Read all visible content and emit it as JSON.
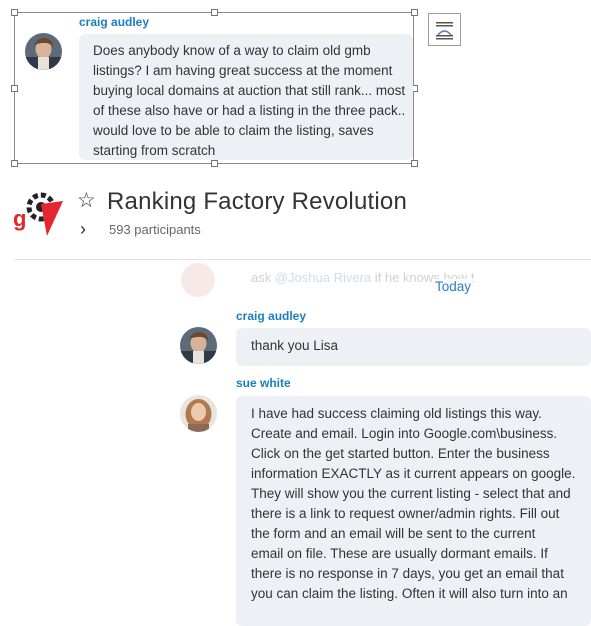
{
  "embedded_message": {
    "sender": "craig audley",
    "text": "Does anybody know of a way to claim old gmb\nlistings?  I am having great success at the moment\nbuying local domains at auction that still rank...  most\nof these also have or had a listing in the three pack..\nwould love to be able to claim the listing, saves\nstarting from scratch"
  },
  "layout_options_icon": "text-wrap-icon",
  "group": {
    "title": "Ranking Factory Revolution",
    "participants": "593 participants",
    "favorite_icon": "star-outline-icon",
    "expand_icon": "chevron-right-icon"
  },
  "faded_message": {
    "prefix": "ask ",
    "mention": "@Joshua Rivera",
    "suffix": " if he knows how t"
  },
  "day_separator": "Today",
  "messages": [
    {
      "sender": "craig audley",
      "text": "thank you Lisa"
    },
    {
      "sender": "sue white",
      "text": "I have had success claiming old listings this way.\nCreate and email. Login into Google.com\\business.\nClick on the get started button. Enter the business\ninformation EXACTLY as it current appears on google.\nThey will show you the current listing - select that and\nthere is a link to request owner/admin rights. Fill out\nthe form and an email will be sent to the current\nemail on file. These are usually dormant emails. If\nthere is no response in 7 days, you get an email that\nyou can claim the listing. Often it will also turn into an"
    }
  ],
  "colors": {
    "sender_name": "#1a7fc1",
    "bubble_bg": "#edf1f6",
    "day_separator": "#2a7fc1",
    "logo_red": "#e3262f"
  }
}
